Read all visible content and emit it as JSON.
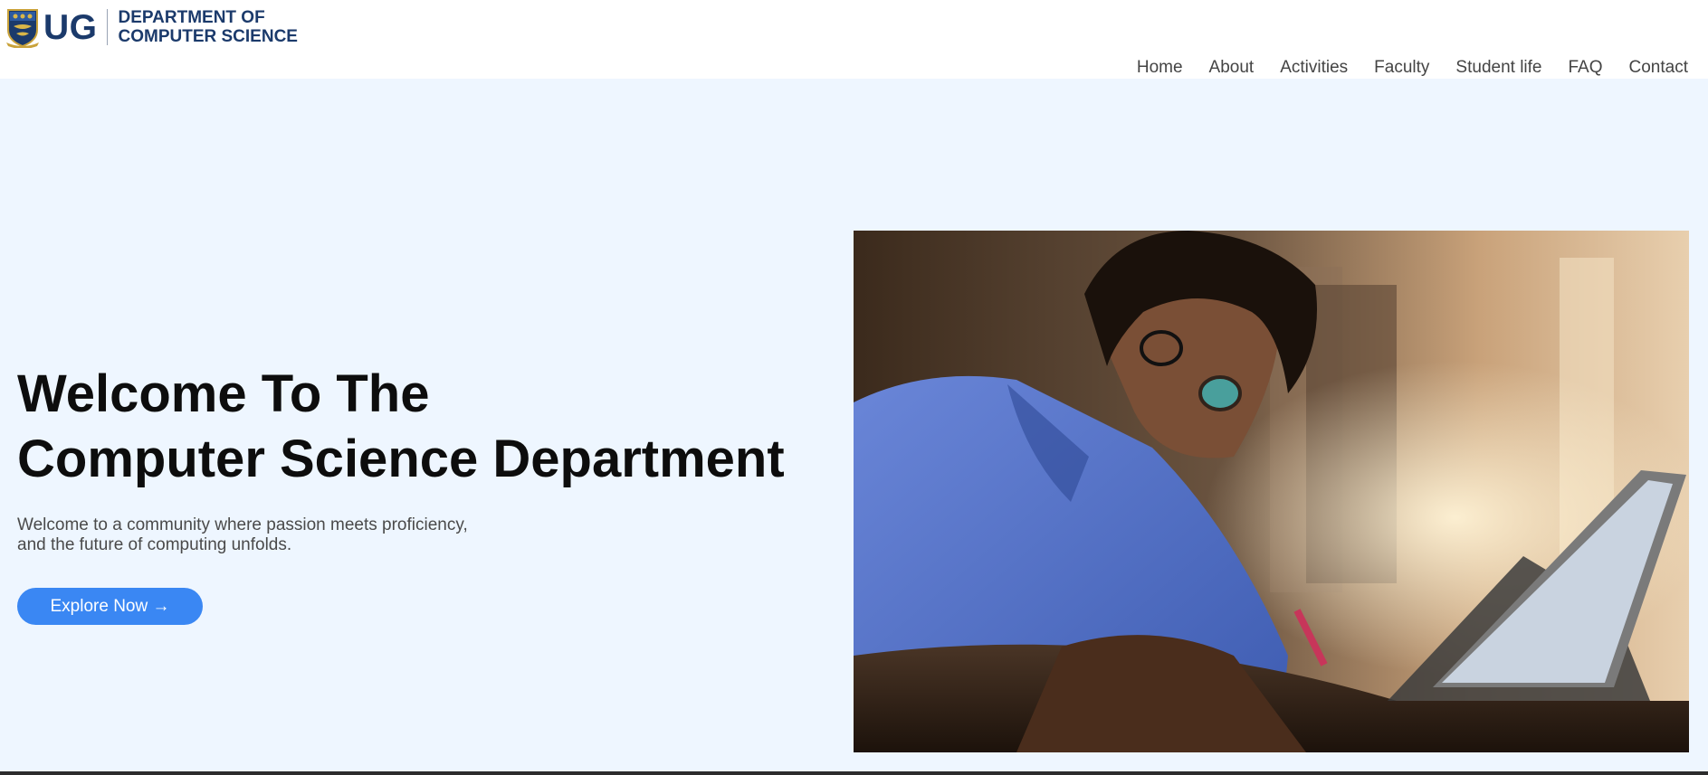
{
  "header": {
    "logo_text": "UG",
    "dept_line1": "DEPARTMENT OF",
    "dept_line2": "COMPUTER SCIENCE",
    "brand_color": "#1b3a6b"
  },
  "nav": {
    "items": [
      {
        "label": "Home"
      },
      {
        "label": "About"
      },
      {
        "label": "Activities"
      },
      {
        "label": "Faculty"
      },
      {
        "label": "Student life"
      },
      {
        "label": "FAQ"
      },
      {
        "label": "Contact"
      }
    ]
  },
  "hero": {
    "title_line1": "Welcome To The",
    "title_line2": "Computer Science Department",
    "subtitle_line1": "Welcome to a community where passion meets proficiency,",
    "subtitle_line2": "and the future of computing unfolds.",
    "cta_label": "Explore Now →",
    "background": "#eef6ff",
    "accent": "#3a87f3"
  }
}
